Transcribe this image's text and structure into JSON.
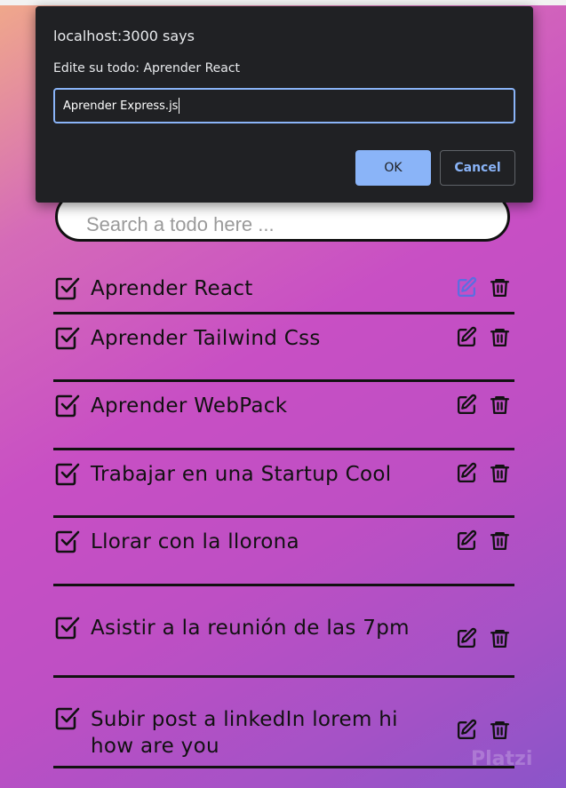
{
  "dialog": {
    "title": "localhost:3000 says",
    "message": "Edite su todo: Aprender React",
    "input_value": "Aprender Express.js",
    "ok_label": "OK",
    "cancel_label": "Cancel"
  },
  "search": {
    "placeholder": "Search a todo here ..."
  },
  "todos": [
    {
      "text": "Aprender React",
      "edit_active": true
    },
    {
      "text": "Aprender Tailwind Css",
      "edit_active": false
    },
    {
      "text": "Aprender WebPack",
      "edit_active": false
    },
    {
      "text": "Trabajar en una Startup Cool",
      "edit_active": false
    },
    {
      "text": "Llorar con la llorona",
      "edit_active": false
    },
    {
      "text": "Asistir a la reunión de las 7pm",
      "edit_active": false
    },
    {
      "text": "Subir post a linkedIn lorem hi how are you",
      "edit_active": false
    }
  ],
  "colors": {
    "text": "#111111",
    "edit_active": "#5b6ee1",
    "dialog_bg": "#202124",
    "dialog_accent": "#8ab4f8"
  },
  "icons": {
    "check": "checkbox-checked-icon",
    "edit": "edit-icon",
    "delete": "trash-icon"
  },
  "watermark": "Platzi"
}
